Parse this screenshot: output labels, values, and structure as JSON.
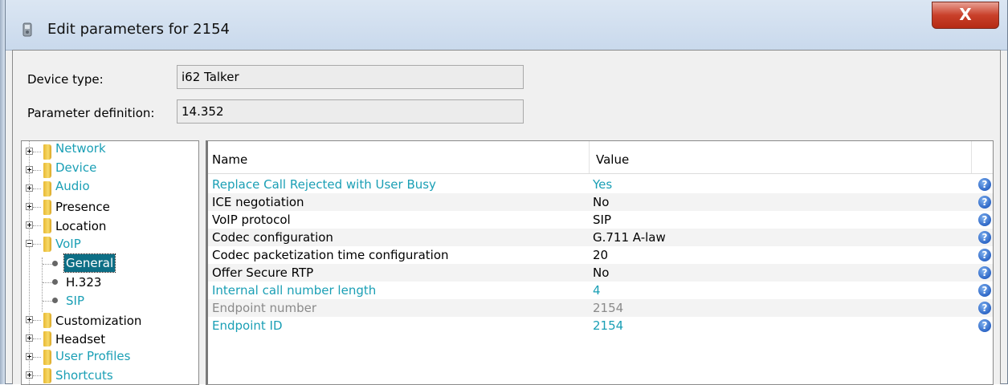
{
  "window": {
    "title": "Edit parameters for 2154",
    "close_label": "X"
  },
  "fields": {
    "device_type_label": "Device type:",
    "device_type_value": "i62 Talker",
    "param_def_label": "Parameter definition:",
    "param_def_value": "14.352"
  },
  "tree": {
    "items": [
      {
        "label": "Network",
        "style": "teal"
      },
      {
        "label": "Device",
        "style": "teal"
      },
      {
        "label": "Audio",
        "style": "teal"
      },
      {
        "label": "Presence",
        "style": "normal"
      },
      {
        "label": "Location",
        "style": "normal"
      },
      {
        "label": "VoIP",
        "style": "teal",
        "expanded": true
      },
      {
        "label": "General",
        "style": "selected"
      },
      {
        "label": "H.323",
        "style": "normal"
      },
      {
        "label": "SIP",
        "style": "teal"
      },
      {
        "label": "Customization",
        "style": "normal"
      },
      {
        "label": "Headset",
        "style": "normal"
      },
      {
        "label": "User Profiles",
        "style": "teal"
      },
      {
        "label": "Shortcuts",
        "style": "teal"
      }
    ]
  },
  "table": {
    "col_name": "Name",
    "col_value": "Value",
    "rows": [
      {
        "name": "Replace Call Rejected with User Busy",
        "value": "Yes",
        "style": "teal"
      },
      {
        "name": "ICE negotiation",
        "value": "No",
        "style": "normal"
      },
      {
        "name": "VoIP protocol",
        "value": "SIP",
        "style": "normal"
      },
      {
        "name": "Codec configuration",
        "value": "G.711 A-law",
        "style": "normal"
      },
      {
        "name": "Codec packetization time configuration",
        "value": "20",
        "style": "normal"
      },
      {
        "name": "Offer Secure RTP",
        "value": "No",
        "style": "normal"
      },
      {
        "name": "Internal call number length",
        "value": "4",
        "style": "teal"
      },
      {
        "name": "Endpoint number",
        "value": "2154",
        "style": "gray"
      },
      {
        "name": "Endpoint ID",
        "value": "2154",
        "style": "teal"
      }
    ],
    "help_icon": "help-icon"
  },
  "colors": {
    "accent": "#1a9fb5",
    "selected_bg": "#0d6f86",
    "close": "#c9402a"
  }
}
